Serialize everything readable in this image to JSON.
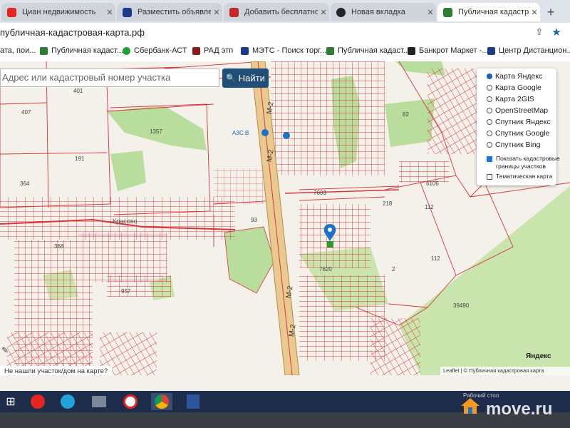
{
  "tabs": [
    {
      "label": "Циан недвижимость",
      "color": "#e52620"
    },
    {
      "label": "Разместить объявление",
      "color": "#1e3a8a"
    },
    {
      "label": "Добавить бесплатное",
      "color": "#c62828"
    },
    {
      "label": "Новая вкладка",
      "color": "#222222"
    },
    {
      "label": "Публичная кадастровая",
      "color": "#2e7d32"
    }
  ],
  "new_tab": "+",
  "address": {
    "url": "публичная-кадастровая-карта.рф"
  },
  "bookmarks": [
    {
      "label": "ата, пои...",
      "color": "#e52620"
    },
    {
      "label": "Публичная кадаст...",
      "color": "#2e7d32"
    },
    {
      "label": "Сбербанк-АСТ",
      "color": "#21a038"
    },
    {
      "label": "РАД этп",
      "color": "#8b1a1a"
    },
    {
      "label": "МЭТС - Поиск торг...",
      "color": "#1e3a8a"
    },
    {
      "label": "Публичная кадаст...",
      "color": "#2e7d32"
    },
    {
      "label": "Банкрот Маркет -...",
      "color": "#222222"
    },
    {
      "label": "Центр Дистанцион...",
      "color": "#1e3a8a"
    }
  ],
  "search": {
    "placeholder": "Адрес или кадастровый номер участка",
    "button": "Найти"
  },
  "layers": {
    "options": [
      {
        "label": "Карта Яндекс",
        "selected": true
      },
      {
        "label": "Карта Google",
        "selected": false
      },
      {
        "label": "Карта 2GIS",
        "selected": false
      },
      {
        "label": "OpenStreetMap",
        "selected": false
      },
      {
        "label": "Спутник Яндекс",
        "selected": false
      },
      {
        "label": "Спутник Google",
        "selected": false
      },
      {
        "label": "Спутник Bing",
        "selected": false
      }
    ],
    "cadastre_line1": "Показать кадастровые",
    "cadastre_line2": "границы участков",
    "thematic": "Тематическая карта"
  },
  "map_labels": {
    "l401": "401",
    "l407": "407",
    "l1357": "1357",
    "l191": "191",
    "l364": "364",
    "l368": "368",
    "l957": "957",
    "l82": "82",
    "l218": "218",
    "l112a": "112",
    "l112b": "112",
    "l6106": "6106",
    "l39490": "39490",
    "l93": "93",
    "l7620": "7620",
    "l7603": "7603",
    "l2": "2",
    "m2a": "М-2",
    "m2b": "М-2",
    "m2c": "М-2",
    "m2d": "М-2",
    "azs": "АЗС В",
    "krasovo": "Красово"
  },
  "not_found": "Не нашли участок/дом на карте?",
  "attribution": "Leaflet | © Публичная кадастровая карта",
  "yandex": "Яндекс",
  "tray": {
    "desktop": "Рабочий стол"
  },
  "watermark": "move.ru",
  "colors": {
    "accent": "#1f4e79",
    "parcel": "#d9343a",
    "road": "#c9a46a",
    "green": "#b9dd9c"
  }
}
